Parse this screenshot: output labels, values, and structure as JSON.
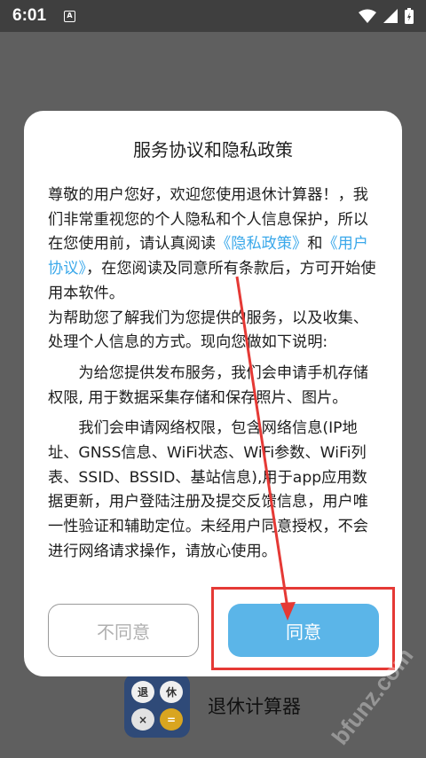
{
  "status_bar": {
    "time": "6:01",
    "notification_glyph": "A"
  },
  "background_app": {
    "name": "退休计算器",
    "icon_keys": [
      "退",
      "休",
      "×",
      "="
    ]
  },
  "dialog": {
    "title": "服务协议和隐私政策",
    "body": {
      "p1_a": "尊敬的用户您好，欢迎您使用退休计算器！，我们非常重视您的个人隐私和个人信息保护，所以在您使用前，请认真阅读",
      "privacy_link": "《隐私政策》",
      "p1_and": "和",
      "agreement_link": "《用户协议》",
      "p1_b": "，在您阅读及同意所有条款后，方可开始使用本软件。",
      "p2": "为帮助您了解我们为您提供的服务，以及收集、处理个人信息的方式。现向您做如下说明:",
      "p3": "为给您提供发布服务，我们会申请手机存储权限, 用于数据采集存储和保存照片、图片。",
      "p4": "我们会申请网络权限，包含网络信息(IP地址、GNSS信息、WiFi状态、WiFi参数、WiFi列表、SSID、BSSID、基站信息),用于app应用数据更新，用户登陆注册及提交反馈信息，用户唯一性验证和辅助定位。未经用户同意授权，不会进行网络请求操作，请放心使用。"
    },
    "decline_label": "不同意",
    "agree_label": "同意"
  },
  "watermark": "bfunz.com",
  "colors": {
    "link": "#3aa8ea",
    "agree_button": "#5bb5e8",
    "annotation": "#e53935",
    "overlay": "#5f5f5f"
  }
}
